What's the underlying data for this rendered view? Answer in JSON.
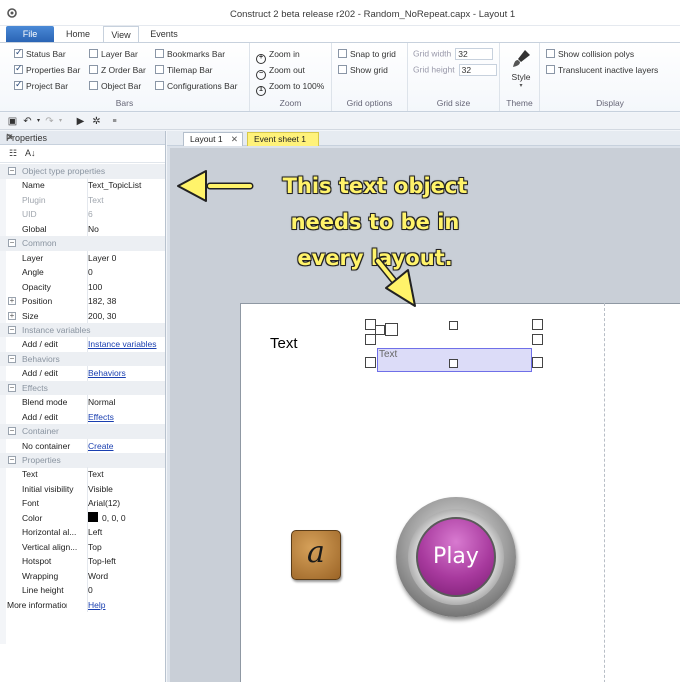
{
  "window": {
    "title": "Construct 2 beta release r202 - Random_NoRepeat.capx - Layout 1"
  },
  "ribbon_tabs": [
    "File",
    "Home",
    "View",
    "Events"
  ],
  "ribbon": {
    "bars": {
      "label": "Bars",
      "items": [
        {
          "label": "Status Bar",
          "checked": true
        },
        {
          "label": "Properties Bar",
          "checked": true
        },
        {
          "label": "Project Bar",
          "checked": true
        },
        {
          "label": "Layer Bar",
          "checked": false
        },
        {
          "label": "Z Order Bar",
          "checked": false
        },
        {
          "label": "Object Bar",
          "checked": false
        },
        {
          "label": "Bookmarks Bar",
          "checked": false
        },
        {
          "label": "Tilemap Bar",
          "checked": false
        },
        {
          "label": "Configurations Bar",
          "checked": false
        }
      ]
    },
    "zoom": {
      "label": "Zoom",
      "zoom_in": "Zoom in",
      "zoom_out": "Zoom out",
      "zoom_100": "Zoom to 100%"
    },
    "grid_options": {
      "label": "Grid options",
      "snap": "Snap to grid",
      "show": "Show grid"
    },
    "grid_size": {
      "label": "Grid size",
      "width_label": "Grid width",
      "width_value": "32",
      "height_label": "Grid height",
      "height_value": "32"
    },
    "theme": {
      "label": "Theme",
      "style": "Style"
    },
    "display": {
      "label": "Display",
      "collision": "Show collision polys",
      "translucent": "Translucent inactive layers"
    }
  },
  "properties_panel": {
    "title": "Properties",
    "rows": [
      {
        "type": "cat",
        "key": "Object type properties"
      },
      {
        "type": "row",
        "key": "Name",
        "value": "Text_TopicList"
      },
      {
        "type": "row",
        "key": "Plugin",
        "value": "Text",
        "dim": true
      },
      {
        "type": "row",
        "key": "UID",
        "value": "6",
        "dim": true
      },
      {
        "type": "row",
        "key": "Global",
        "value": "No"
      },
      {
        "type": "cat",
        "key": "Common"
      },
      {
        "type": "row",
        "key": "Layer",
        "value": "Layer 0"
      },
      {
        "type": "row",
        "key": "Angle",
        "value": "0"
      },
      {
        "type": "row",
        "key": "Opacity",
        "value": "100"
      },
      {
        "type": "row",
        "key": "Position",
        "value": "182, 38",
        "expand": true
      },
      {
        "type": "row",
        "key": "Size",
        "value": "200, 30",
        "expand": true
      },
      {
        "type": "cat",
        "key": "Instance variables"
      },
      {
        "type": "row",
        "key": "Add / edit",
        "value": "Instance variables",
        "link": true
      },
      {
        "type": "cat",
        "key": "Behaviors"
      },
      {
        "type": "row",
        "key": "Add / edit",
        "value": "Behaviors",
        "link": true
      },
      {
        "type": "cat",
        "key": "Effects"
      },
      {
        "type": "row",
        "key": "Blend mode",
        "value": "Normal"
      },
      {
        "type": "row",
        "key": "Add / edit",
        "value": "Effects",
        "link": true
      },
      {
        "type": "cat",
        "key": "Container"
      },
      {
        "type": "row",
        "key": "No container",
        "value": "Create",
        "link": true
      },
      {
        "type": "cat",
        "key": "Properties"
      },
      {
        "type": "row",
        "key": "Text",
        "value": "Text"
      },
      {
        "type": "row",
        "key": "Initial visibility",
        "value": "Visible"
      },
      {
        "type": "row",
        "key": "Font",
        "value": "Arial(12)"
      },
      {
        "type": "row",
        "key": "Color",
        "value": "0, 0, 0",
        "swatch": "#000000"
      },
      {
        "type": "row",
        "key": "Horizontal al...",
        "value": "Left"
      },
      {
        "type": "row",
        "key": "Vertical align...",
        "value": "Top"
      },
      {
        "type": "row",
        "key": "Hotspot",
        "value": "Top-left"
      },
      {
        "type": "row",
        "key": "Wrapping",
        "value": "Word"
      },
      {
        "type": "row",
        "key": "Line height",
        "value": "0"
      },
      {
        "type": "info",
        "key": "More information",
        "value": "Help",
        "link": true
      }
    ]
  },
  "doc_tabs": {
    "layout": "Layout 1",
    "events": "Event sheet 1"
  },
  "canvas": {
    "annotation_lines": [
      "This text object",
      "needs to be in",
      "every layout."
    ],
    "text_object_label": "Text",
    "selected_text": "Text",
    "tile_letter": "a",
    "play_label": "Play",
    "note_color": "#fff36a"
  }
}
